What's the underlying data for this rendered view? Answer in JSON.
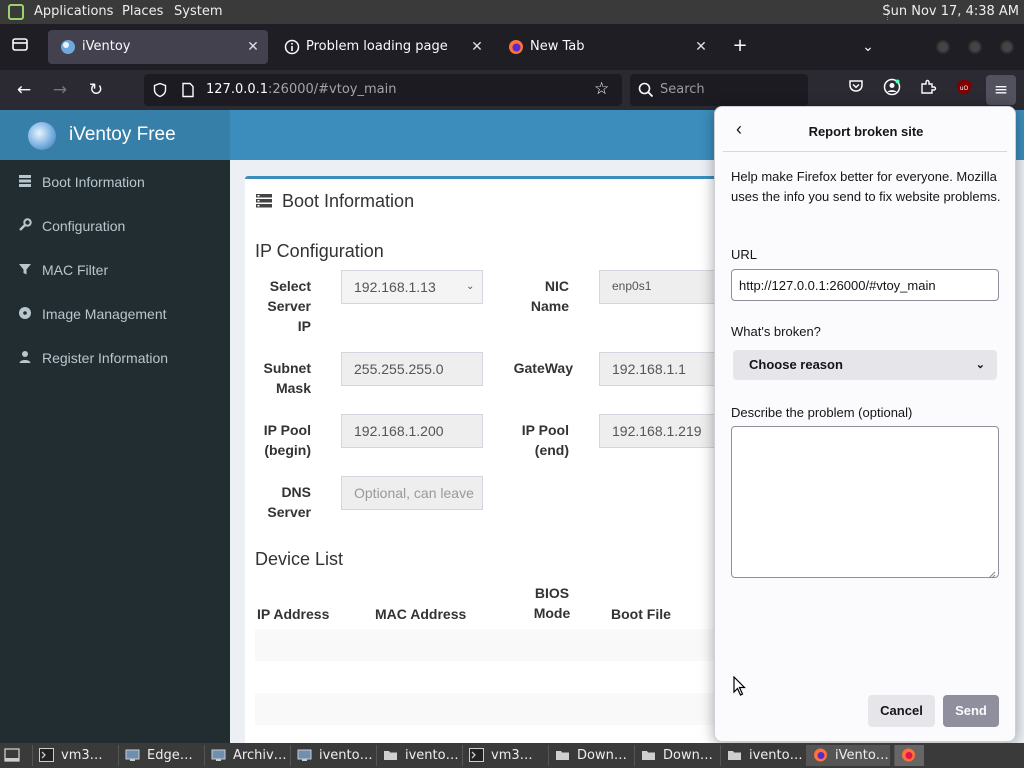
{
  "system_panel": {
    "menus": [
      "Applications",
      "Places",
      "System"
    ],
    "clock": "Sun Nov 17,  4:38 AM"
  },
  "browser": {
    "tabs": [
      {
        "label": "iVentoy",
        "icon": "iventoy-favicon-icon",
        "active": true
      },
      {
        "label": "Problem loading page",
        "icon": "info-icon",
        "active": false
      },
      {
        "label": "New Tab",
        "icon": "firefox-icon",
        "active": false
      }
    ],
    "url_host": "127.0.0.1",
    "url_rest": ":26000/#vtoy_main",
    "search_placeholder": "Search"
  },
  "app": {
    "brand": "iVentoy Free",
    "sidebar": [
      {
        "label": "Boot Information",
        "icon": "server-icon"
      },
      {
        "label": "Configuration",
        "icon": "wrench-icon"
      },
      {
        "label": "MAC Filter",
        "icon": "filter-icon"
      },
      {
        "label": "Image Management",
        "icon": "disc-icon"
      },
      {
        "label": "Register Information",
        "icon": "user-icon"
      }
    ],
    "box_title": "Boot Information",
    "ip_section": "IP Configuration",
    "fields": {
      "server_ip_label": "Select Server IP",
      "server_ip_value": "192.168.1.13",
      "nic_label": "NIC Name",
      "nic_value": "enp0s1",
      "subnet_label": "Subnet Mask",
      "subnet_value": "255.255.255.0",
      "gateway_label": "GateWay",
      "gateway_value": "192.168.1.1",
      "pool_begin_label": "IP Pool (begin)",
      "pool_begin_value": "192.168.1.200",
      "pool_end_label": "IP Pool (end)",
      "pool_end_value": "192.168.1.219",
      "dns_label": "DNS Server",
      "dns_placeholder": "Optional, can leave"
    },
    "device_section": "Device List",
    "device_columns": [
      "IP Address",
      "MAC Address",
      "BIOS Mode",
      "Boot File"
    ]
  },
  "report_panel": {
    "title": "Report broken site",
    "intro": "Help make Firefox better for everyone. Mozilla uses the info you send to fix website problems.",
    "url_label": "URL",
    "url_value": "http://127.0.0.1:26000/#vtoy_main",
    "broken_label": "What's broken?",
    "reason_select": "Choose reason",
    "describe_label": "Describe the problem (optional)",
    "cancel": "Cancel",
    "send": "Send"
  },
  "taskbar": [
    {
      "label": "vm3…",
      "icon": "terminal-icon"
    },
    {
      "label": "Edge…",
      "icon": "screenshot-icon"
    },
    {
      "label": "Archiv…",
      "icon": "screenshot-icon"
    },
    {
      "label": "ivento…",
      "icon": "screenshot-icon"
    },
    {
      "label": "ivento…",
      "icon": "folder-icon"
    },
    {
      "label": "vm3…",
      "icon": "terminal-icon"
    },
    {
      "label": "Down…",
      "icon": "folder-icon"
    },
    {
      "label": "Down…",
      "icon": "folder-icon"
    },
    {
      "label": "ivento…",
      "icon": "folder-icon"
    },
    {
      "label": "iVento…",
      "icon": "firefox-icon"
    }
  ],
  "colors": {
    "brand_bar": "#367fa9",
    "top_nav": "#3c8dbc",
    "sidebar": "#222d32",
    "firefox_toolbar": "#2b2a33"
  }
}
